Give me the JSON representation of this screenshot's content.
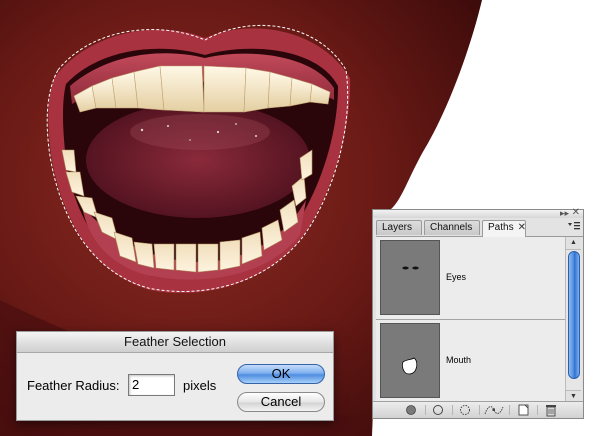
{
  "paths_panel": {
    "tabs": [
      {
        "label": "Layers",
        "active": false
      },
      {
        "label": "Channels",
        "active": false
      },
      {
        "label": "Paths",
        "active": true
      }
    ],
    "close_glyph": "✕",
    "collapse_glyph": "▸▸",
    "tab_close_glyph": "✕",
    "rows": [
      {
        "label": "Eyes",
        "selected": false
      },
      {
        "label": "Mouth",
        "selected": true
      }
    ],
    "footer_buttons": [
      "fill-path-icon",
      "stroke-path-icon",
      "load-path-as-selection-icon",
      "make-work-path-icon",
      "create-new-path-icon",
      "delete-path-icon"
    ]
  },
  "dialog": {
    "title": "Feather Selection",
    "field_label": "Feather Radius:",
    "field_value": "2",
    "unit": "pixels",
    "ok_label": "OK",
    "cancel_label": "Cancel"
  },
  "colors": {
    "ok_button": "#5a9be8",
    "scroll_thumb": "#3b7cd8",
    "path_thumb_bg": "#7a7a7a"
  }
}
